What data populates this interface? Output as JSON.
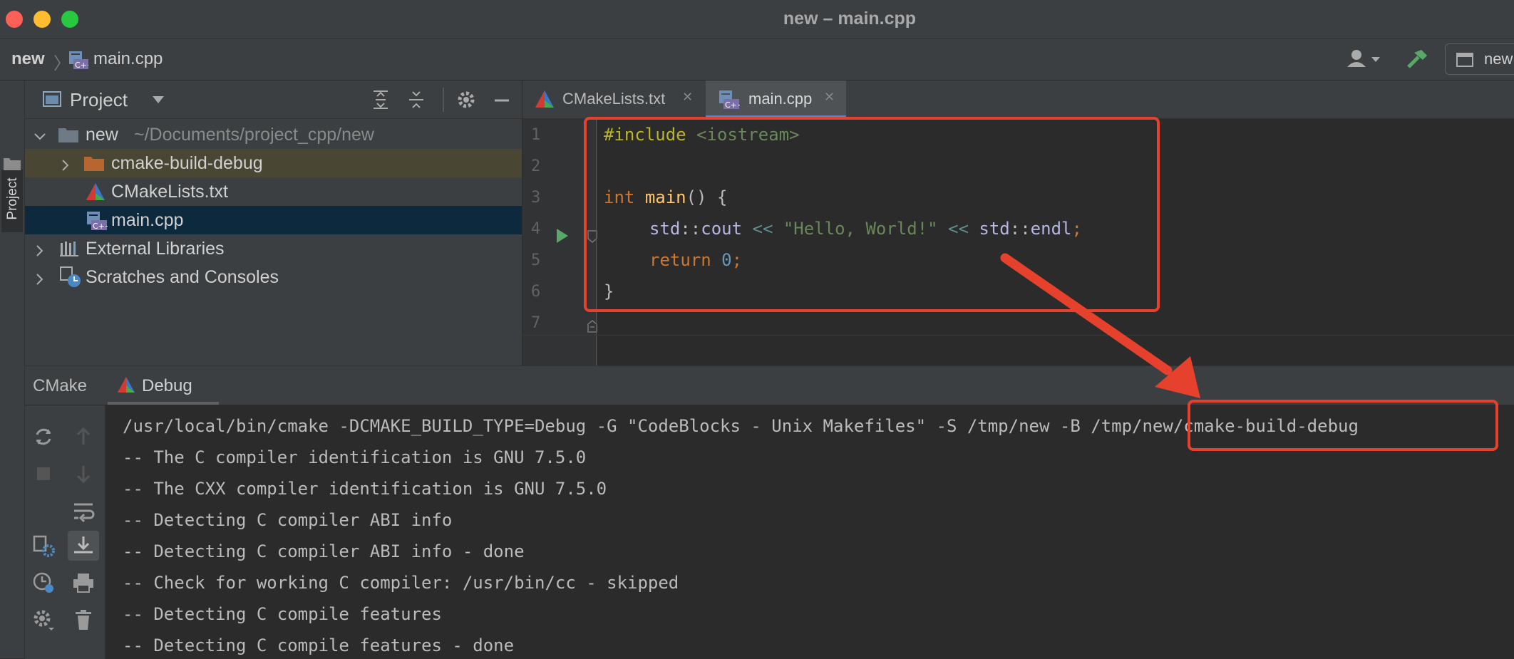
{
  "window": {
    "title": "new – main.cpp"
  },
  "navbar": {
    "project": "new",
    "file": "main.cpp",
    "right_label": "new"
  },
  "sidebar": {
    "project_tab": "Project"
  },
  "project_panel": {
    "title": "Project",
    "tree": [
      {
        "label": "new",
        "path": "~/Documents/project_cpp/new"
      },
      {
        "label": "cmake-build-debug"
      },
      {
        "label": "CMakeLists.txt"
      },
      {
        "label": "main.cpp"
      },
      {
        "label": "External Libraries"
      },
      {
        "label": "Scratches and Consoles"
      }
    ]
  },
  "editor": {
    "tabs": [
      {
        "label": "CMakeLists.txt",
        "close": "✕"
      },
      {
        "label": "main.cpp",
        "close": "✕"
      }
    ],
    "line_numbers": [
      "1",
      "2",
      "3",
      "4",
      "5",
      "6",
      "7"
    ],
    "code": {
      "l1_kw": "#include",
      "l1_hdr": "<iostream>",
      "l3_type": "int",
      "l3_fn": "main",
      "l3_rest": "() {",
      "l4_ns1": "std",
      "l4_sep1": "::",
      "l4_cout": "cout",
      "l4_op1": " << ",
      "l4_str": "\"Hello, World!\"",
      "l4_op2": " << ",
      "l4_ns2": "std",
      "l4_sep2": "::",
      "l4_endl": "endl",
      "l4_semi": ";",
      "l5_kw": "return",
      "l5_num": "0",
      "l5_semi": ";",
      "l6": "}"
    }
  },
  "bottom": {
    "tabs": [
      {
        "label": "CMake"
      },
      {
        "label": "Debug"
      }
    ],
    "output": {
      "cmd_prefix": "/usr/local/bin/cmake -DCMAKE_BUILD_TYPE=Debug -G \"CodeBlocks - Unix Makefiles\" -S /tmp/new -B",
      "cmd_path": "/tmp/new/cmake-build-debug",
      "lines": [
        "-- The C compiler identification is GNU 7.5.0",
        "-- The CXX compiler identification is GNU 7.5.0",
        "-- Detecting C compiler ABI info",
        "-- Detecting C compiler ABI info - done",
        "-- Check for working C compiler: /usr/bin/cc - skipped",
        "-- Detecting C compile features",
        "-- Detecting C compile features - done"
      ]
    }
  },
  "colors": {
    "keyword": "#cc7832",
    "string": "#6a8759",
    "function": "#ffc66d",
    "number": "#6897bb",
    "member": "#9876aa",
    "preprocessor": "#bbb529",
    "annotation": "#e5412d"
  }
}
